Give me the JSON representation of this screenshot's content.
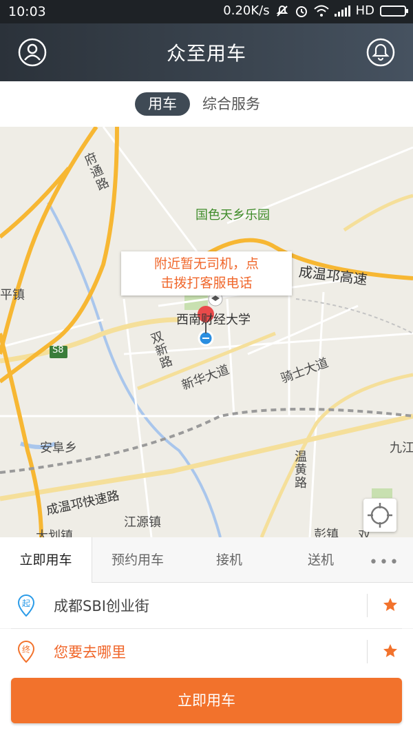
{
  "statusbar": {
    "time": "10:03",
    "network_speed": "0.20K/s",
    "hd": "HD"
  },
  "app": {
    "title": "众至用车"
  },
  "segments": {
    "active": "用车",
    "inactive": "综合服务"
  },
  "map": {
    "labels": {
      "fu_tong_lu": "府\n通\n路",
      "park": "国色天乡乐园",
      "pingzhen": "平镇",
      "highway": "成温邛高速",
      "university": "西南财经大学",
      "shuangxin": "双\n新\n路",
      "xinhua": "新华大道",
      "qishi": "骑士大道",
      "s8": "S8",
      "anfu": "安阜乡",
      "jiujiang": "九江",
      "wenhuang": "温\n黄\n路",
      "express": "成温邛快速路",
      "jiangyuan": "江源镇",
      "dahua": "大划镇",
      "pengzhen": "彭镇",
      "shuang": "双"
    },
    "callout_line1": "附近暂无司机，点",
    "callout_line2": "击拨打客服电话"
  },
  "service_tabs": {
    "tabs": [
      "立即用车",
      "预约用车",
      "接机",
      "送机"
    ],
    "more": "•••"
  },
  "start": {
    "text": "成都SBI创业街",
    "pin_label": "起"
  },
  "end": {
    "text": "您要去哪里",
    "pin_label": "终"
  },
  "cta": {
    "label": "立即用车"
  },
  "colors": {
    "accent": "#f2722c",
    "header": "#2b323a",
    "pin_start": "#2a9be8",
    "pin_end": "#f2722c"
  },
  "icons": [
    "profile-icon",
    "bell-icon",
    "locate-icon",
    "star-icon",
    "location-pin-icon"
  ]
}
